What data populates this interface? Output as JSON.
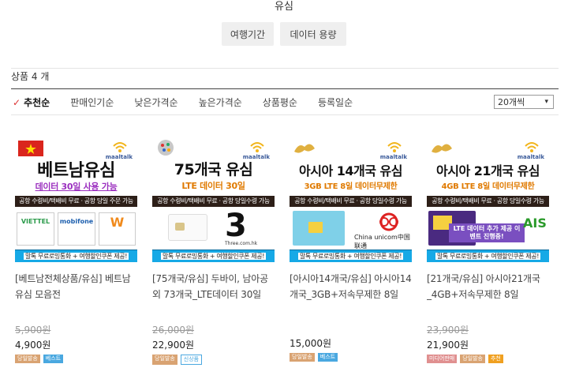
{
  "page": {
    "title": "유심"
  },
  "filters": [
    {
      "label": "여행기간"
    },
    {
      "label": "데이터 용량"
    }
  ],
  "count_text": "상품 4 개",
  "sort": {
    "items": [
      {
        "label": "추천순",
        "active": true
      },
      {
        "label": "판매인기순",
        "active": false
      },
      {
        "label": "낮은가격순",
        "active": false
      },
      {
        "label": "높은가격순",
        "active": false
      },
      {
        "label": "상품평순",
        "active": false
      },
      {
        "label": "등록일순",
        "active": false
      }
    ],
    "per_page": "20개씩"
  },
  "products": [
    {
      "thumb": {
        "headline": "베트남유심",
        "sub": "데이터 30일 사용 가능",
        "band": "공항 수령비/택배비 무료 · 공항 당일 주문 가능",
        "band_blue": "말톡 무료로밍통화 + 여행할인쿠폰 제공!",
        "sub_color": "#9b2fbf"
      },
      "title": "[베트남전체상품/유심] 베트남 유심 모음전",
      "price_old": "5,900원",
      "price": "4,900원",
      "badges": [
        {
          "label": "당일발송",
          "style": "tan"
        },
        {
          "label": "베스트",
          "style": "blue"
        }
      ]
    },
    {
      "thumb": {
        "headline": "75개국 유심",
        "sub": "LTE 데이터 30일",
        "band": "공항 수령비/택배비 무료 · 공항 당일수령 가능",
        "band_blue": "말톡 무료로밍통화 + 여행할인쿠폰 제공!",
        "sub_color": "#e07a00"
      },
      "title": "[75개국/유심] 두바이, 남아공 외 73개국_LTE데이터 30일",
      "price_old": "26,000원",
      "price": "22,900원",
      "badges": [
        {
          "label": "당일발송",
          "style": "tan"
        },
        {
          "label": "신상품",
          "style": "outline"
        }
      ]
    },
    {
      "thumb": {
        "headline": "아시아 14개국 유심",
        "sub": "3GB LTE 8일 데이터무제한",
        "band": "공항 수령비/택배비 무료 · 공항 당일수령 가능",
        "band_blue": "말톡 무료로밍통화 + 여행할인쿠폰 제공!",
        "sub_color": "#e07a00"
      },
      "title": "[아시아14개국/유심] 아시아14개국_3GB+저속무제한 8일",
      "price_old": "",
      "price": "15,000원",
      "badges": [
        {
          "label": "당일발송",
          "style": "tan"
        },
        {
          "label": "베스트",
          "style": "blue"
        }
      ]
    },
    {
      "thumb": {
        "headline": "아시아 21개국 유심",
        "sub": "4GB LTE 8일 데이터무제한",
        "band": "공항 수령비/택배비 무료 · 공항 당일수령 가능",
        "band_blue": "말톡 무료로밍통화 + 여행할인쿠폰 제공!",
        "sub_color": "#e07a00"
      },
      "title": "[21개국/유심] 아시아21개국_4GB+저속무제한 8일",
      "price_old": "23,900원",
      "price": "21,900원",
      "badges": [
        {
          "label": "미디어판매",
          "style": "pink"
        },
        {
          "label": "당일발송",
          "style": "tan"
        },
        {
          "label": "추천",
          "style": "orange"
        }
      ]
    }
  ],
  "brand": {
    "logo_text": "maaltalk"
  },
  "thumb_art": {
    "carriers": [
      "VIETTEL",
      "mobifone",
      "W"
    ],
    "sim_text": "Three.com.hk",
    "china_text": "China unicom中国联通",
    "ais_text": "AIS",
    "promo_text": "LTE 데이터 추가 제공 이벤트 진행중!"
  }
}
